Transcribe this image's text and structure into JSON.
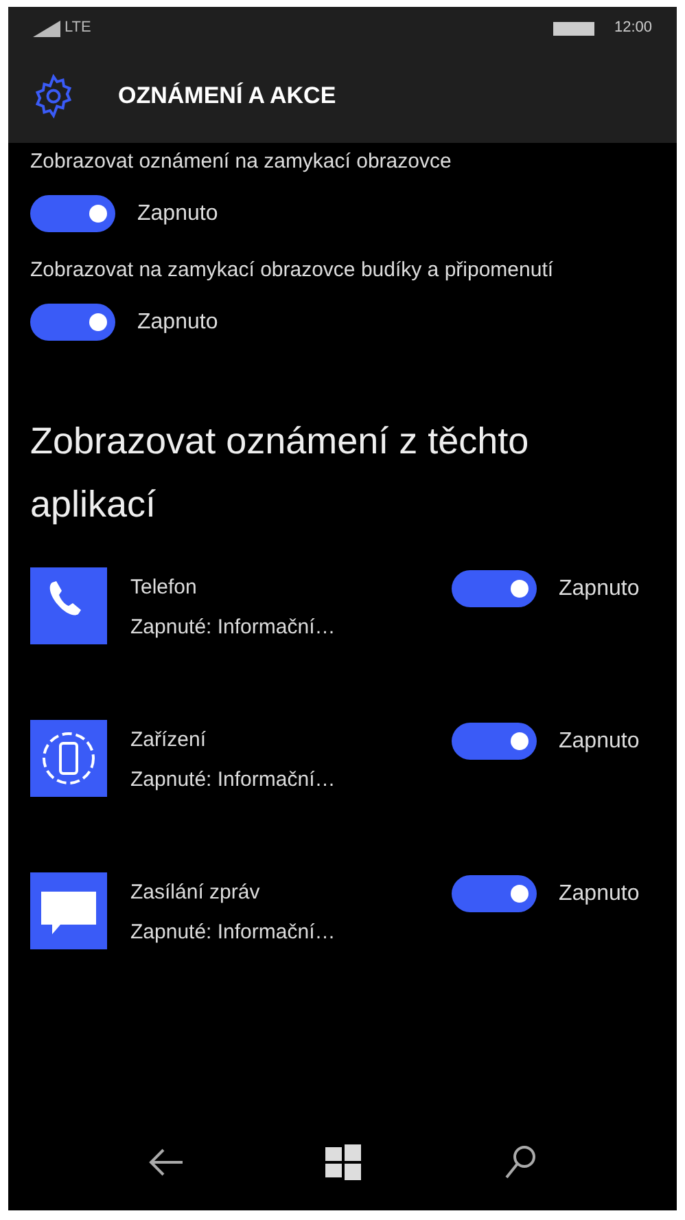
{
  "status_bar": {
    "network": "LTE",
    "time": "12:00"
  },
  "header": {
    "title": "OZNÁMENÍ A AKCE"
  },
  "settings": [
    {
      "label": "Zobrazovat oznámení na zamykací obrazovce",
      "on": true,
      "state_label": "Zapnuto"
    },
    {
      "label": "Zobrazovat na zamykací obrazovce budíky a připomenutí",
      "on": true,
      "state_label": "Zapnuto"
    }
  ],
  "section_heading": "Zobrazovat oznámení z těchto aplikací",
  "apps": [
    {
      "kind": "phone",
      "name": "Telefon",
      "detail": "Zapnuté: Informační…",
      "on": true,
      "state_label": "Zapnuto"
    },
    {
      "kind": "device",
      "name": "Zařízení",
      "detail": "Zapnuté: Informační…",
      "on": true,
      "state_label": "Zapnuto"
    },
    {
      "kind": "messaging",
      "name": "Zasílání zpráv",
      "detail": "Zapnuté: Informační…",
      "on": true,
      "state_label": "Zapnuto"
    }
  ]
}
